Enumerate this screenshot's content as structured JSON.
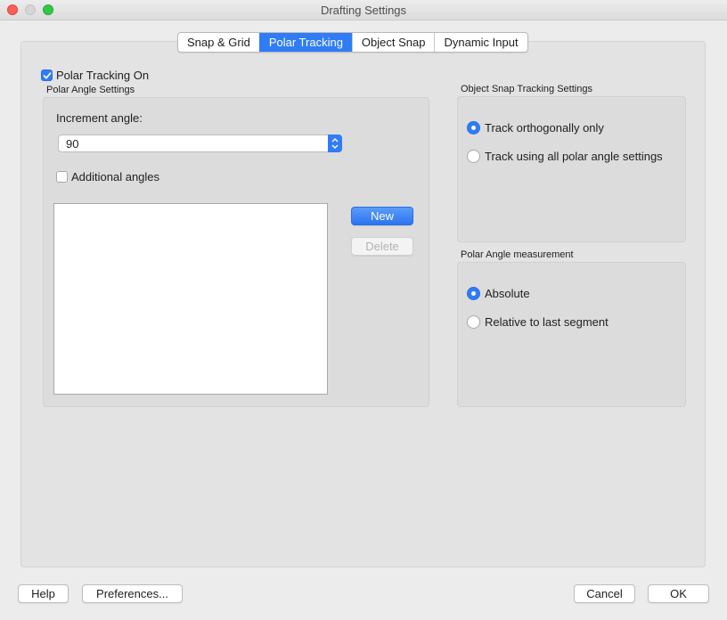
{
  "window": {
    "title": "Drafting Settings"
  },
  "tabs": [
    {
      "label": "Snap & Grid"
    },
    {
      "label": "Polar Tracking"
    },
    {
      "label": "Object Snap"
    },
    {
      "label": "Dynamic Input"
    }
  ],
  "active_tab": "Polar Tracking",
  "polar_tracking_on": {
    "label": "Polar Tracking On",
    "checked": true
  },
  "polar_angle_settings": {
    "title": "Polar Angle Settings",
    "increment_label": "Increment angle:",
    "increment_value": "90",
    "additional_angles": {
      "label": "Additional angles",
      "checked": false
    },
    "new_button": "New",
    "delete_button": "Delete"
  },
  "object_snap_tracking": {
    "title": "Object Snap Tracking Settings",
    "options": [
      {
        "label": "Track orthogonally only",
        "selected": true
      },
      {
        "label": "Track using all polar angle settings",
        "selected": false
      }
    ]
  },
  "polar_angle_measurement": {
    "title": "Polar Angle measurement",
    "options": [
      {
        "label": "Absolute",
        "selected": true
      },
      {
        "label": "Relative to last segment",
        "selected": false
      }
    ]
  },
  "footer": {
    "help": "Help",
    "preferences": "Preferences...",
    "cancel": "Cancel",
    "ok": "OK"
  },
  "colors": {
    "accent": "#2f7cf6"
  }
}
